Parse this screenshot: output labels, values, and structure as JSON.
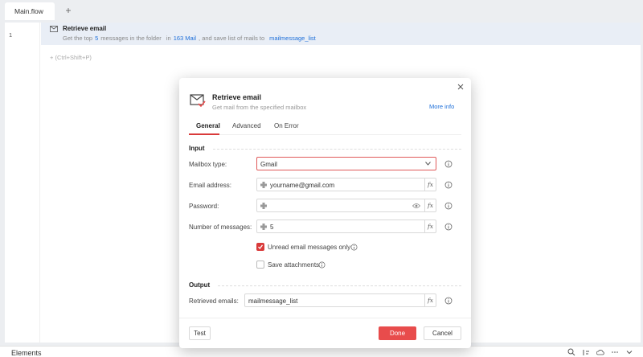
{
  "tabbar": {
    "tab_label": "Main.flow",
    "add_label": "+"
  },
  "flow": {
    "line_number": "1",
    "step": {
      "title": "Retrieve email",
      "desc_prefix": "Get the top",
      "count": "5",
      "desc_mid1": "messages in the folder",
      "desc_in": "in",
      "folder": "163 Mail",
      "desc_mid2": ", and save list of mails to",
      "var_name": "mailmessage_list"
    },
    "add_hint": "+ (Ctrl+Shift+P)"
  },
  "bottom_panel": {
    "title": "Elements"
  },
  "dialog": {
    "title": "Retrieve email",
    "subtitle": "Get mail from the specified mailbox",
    "more_info": "More info",
    "tabs": [
      "General",
      "Advanced",
      "On Error"
    ],
    "input_section": "Input",
    "output_section": "Output",
    "fields": {
      "mailbox_type": {
        "label": "Mailbox type:",
        "value": "Gmail"
      },
      "email": {
        "label": "Email address:",
        "value": "yourname@gmail.com"
      },
      "password": {
        "label": "Password:",
        "value": ""
      },
      "num_messages": {
        "label": "Number of messages:",
        "value": "5"
      },
      "unread_only": {
        "label": "Unread email messages only",
        "checked": true
      },
      "save_attachments": {
        "label": "Save attachments",
        "checked": false
      },
      "retrieved": {
        "label": "Retrieved emails:",
        "value": "mailmessage_list"
      }
    },
    "fx_label": "fx",
    "buttons": {
      "test": "Test",
      "done": "Done",
      "cancel": "Cancel"
    }
  },
  "colors": {
    "accent": "#e84c4c",
    "link": "#1e6fd9",
    "step_bg": "#e9eef6"
  }
}
